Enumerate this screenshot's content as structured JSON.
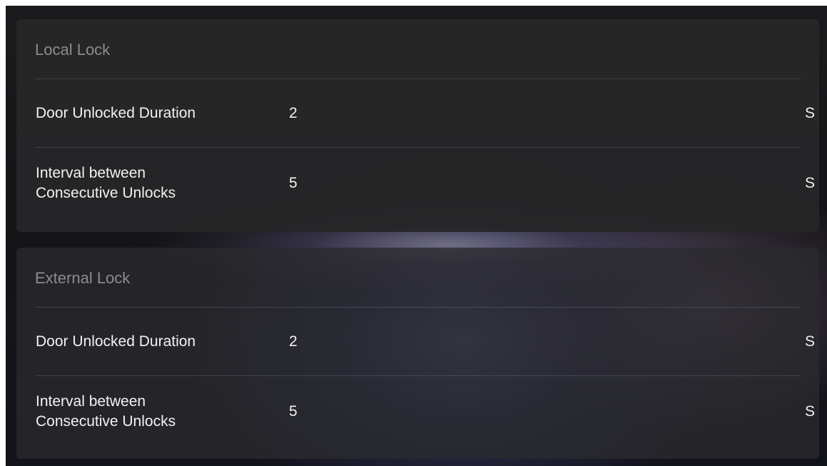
{
  "sections": [
    {
      "title": "Local Lock",
      "rows": [
        {
          "label": "Door Unlocked Duration",
          "value": "2",
          "unit": "S"
        },
        {
          "label": "Interval between\nConsecutive Unlocks",
          "value": "5",
          "unit": "S"
        }
      ]
    },
    {
      "title": "External Lock",
      "rows": [
        {
          "label": "Door Unlocked Duration",
          "value": "2",
          "unit": "S"
        },
        {
          "label": "Interval between\nConsecutive Unlocks",
          "value": "5",
          "unit": "S"
        }
      ]
    }
  ]
}
